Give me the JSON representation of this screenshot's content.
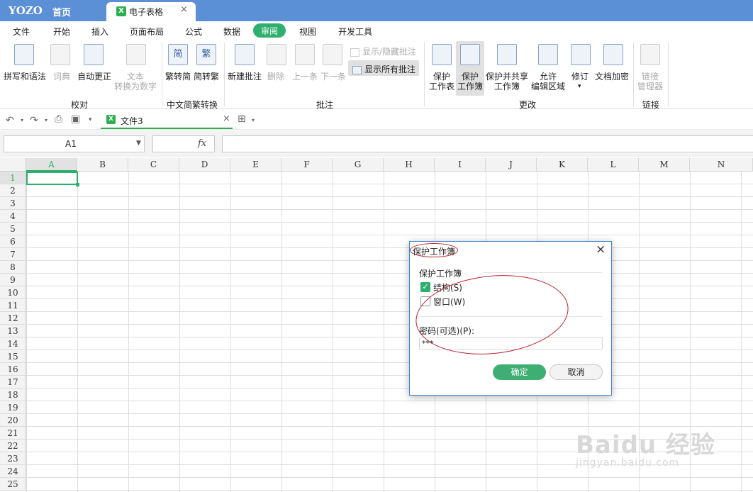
{
  "tabbar": {
    "brand": "YOZO",
    "home": "首页",
    "doc_tab": "电子表格",
    "doc_close": "×"
  },
  "menu": {
    "items": [
      "文件",
      "开始",
      "插入",
      "页面布局",
      "公式",
      "数据",
      "审阅",
      "视图",
      "开发工具"
    ],
    "active": "审阅"
  },
  "ribbon": {
    "spell": "拼写和语法",
    "dictionary": "词典",
    "autocorrect": "自动更正",
    "text_to_num_1": "文本",
    "text_to_num_2": "转换为数字",
    "group_proof": "校对",
    "trad_to_simp": "繁转简",
    "simp_to_trad": "简转繁",
    "group_chinese": "中文简繁转换",
    "new_comment": "新建批注",
    "delete": "删除",
    "prev": "上一条",
    "next": "下一条",
    "show_hide_comment": "显示/隐藏批注",
    "show_all_comments": "显示所有批注",
    "group_comment": "批注",
    "protect_sheet_1": "保护",
    "protect_sheet_2": "工作表",
    "protect_book_1": "保护",
    "protect_book_2": "工作簿",
    "protect_share_1": "保护并共享",
    "protect_share_2": "工作簿",
    "allow_edit_1": "允许",
    "allow_edit_2": "编辑区域",
    "revise": "修订",
    "encrypt": "文档加密",
    "group_changes": "更改",
    "link_mgr_1": "链接",
    "link_mgr_2": "管理器",
    "group_link": "链接",
    "icon_jian": "简",
    "icon_fan": "繁"
  },
  "quickbar": {
    "file_tab": "文件3",
    "file_close": "×"
  },
  "formula": {
    "cell_ref": "A1",
    "fx": "fx",
    "content": ""
  },
  "grid": {
    "columns": [
      "A",
      "B",
      "C",
      "D",
      "E",
      "F",
      "G",
      "H",
      "I",
      "J",
      "K",
      "L",
      "M",
      "N"
    ],
    "rows": [
      "1",
      "2",
      "3",
      "4",
      "5",
      "6",
      "7",
      "8",
      "9",
      "10",
      "11",
      "12",
      "13",
      "14",
      "15",
      "16",
      "17",
      "18",
      "19",
      "20",
      "21",
      "22",
      "23",
      "24",
      "25"
    ]
  },
  "dialog": {
    "title": "保护工作簿",
    "close": "×",
    "section": "保护工作簿",
    "structure_label": "结构(S)",
    "structure_checked": true,
    "window_label": "窗口(W)",
    "window_checked": false,
    "password_label": "密码(可选)(P):",
    "password_value": "***",
    "ok": "确定",
    "cancel": "取消"
  },
  "watermark": {
    "logo": "Baidu 经验",
    "url": "jingyan.baidu.com"
  },
  "colors": {
    "accent": "#2eaf6e",
    "tabbar": "#5b8fd6",
    "annotation": "#c0232c"
  }
}
